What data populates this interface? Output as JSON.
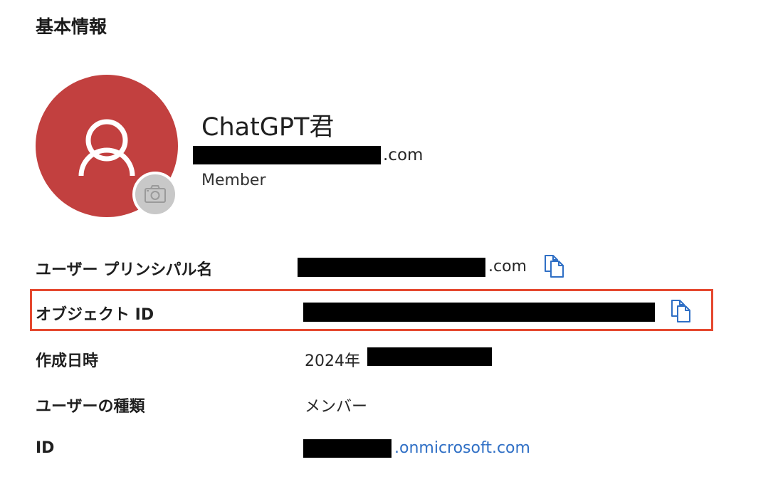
{
  "section": {
    "title": "基本情報"
  },
  "profile": {
    "display_name": "ChatGPT君",
    "email_suffix": ".com",
    "role": "Member",
    "avatar_color": "#c2403f",
    "avatar_icon": "person-icon",
    "photo_icon": "camera-icon"
  },
  "details": {
    "upn": {
      "label": "ユーザー プリンシパル名",
      "value_suffix": ".com",
      "copy_icon": "copy-icon"
    },
    "object_id": {
      "label": "オブジェクト ID",
      "copy_icon": "copy-icon",
      "highlight_color": "#e5482f"
    },
    "created": {
      "label": "作成日時",
      "value_prefix": "2024年"
    },
    "user_type": {
      "label": "ユーザーの種類",
      "value": "メンバー"
    },
    "identity": {
      "label": "ID",
      "value_suffix": ".onmicrosoft.com",
      "link_color": "#2f6fc5"
    }
  }
}
